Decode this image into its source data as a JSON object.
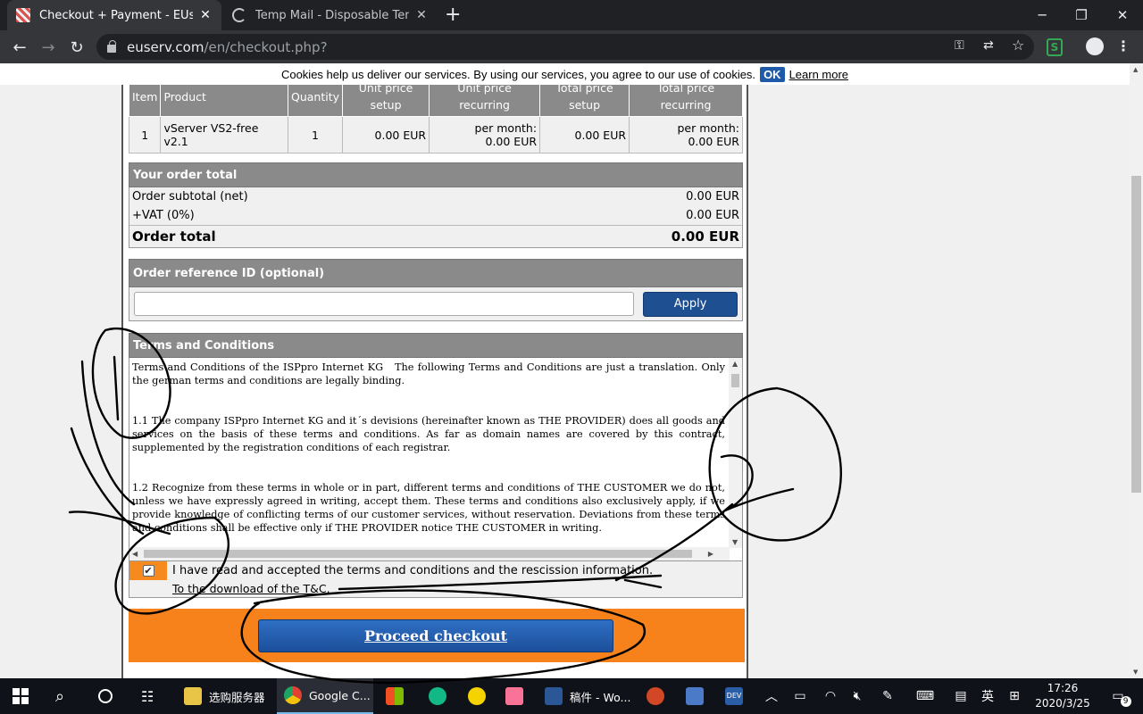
{
  "browser": {
    "tabs": [
      {
        "title": "Checkout + Payment - EUserv",
        "active": true
      },
      {
        "title": "Temp Mail - Disposable Temp",
        "active": false
      }
    ],
    "url_main": "euserv.com",
    "url_path": "/en/checkout.php?"
  },
  "cookie_bar": {
    "text": "Cookies help us deliver our services. By using our services, you agree to our use of cookies.",
    "ok_label": "OK",
    "learn_more": "Learn more"
  },
  "items_table": {
    "headers": [
      "Item",
      "Product",
      "Quantity",
      "Unit price setup",
      "Unit price recurring",
      "Total price setup",
      "Total price recurring"
    ],
    "row": {
      "item": "1",
      "product": "vServer VS2-free v2.1",
      "quantity": "1",
      "unit_setup": "0.00 EUR",
      "unit_recurring_line1": "per month:",
      "unit_recurring_line2": "0.00 EUR",
      "total_setup": "0.00 EUR",
      "total_recurring_line1": "per month:",
      "total_recurring_line2": "0.00 EUR"
    }
  },
  "order_total": {
    "heading": "Your order total",
    "subtotal_label": "Order subtotal (net)",
    "subtotal_value": "0.00 EUR",
    "vat_label": "+VAT (0%)",
    "vat_value": "0.00 EUR",
    "total_label": "Order total",
    "total_value": "0.00 EUR"
  },
  "order_reference": {
    "heading": "Order reference ID (optional)",
    "input_value": "",
    "apply_label": "Apply"
  },
  "terms": {
    "heading": "Terms and Conditions",
    "body": "Terms and Conditions of the ISPpro Internet KG   The following Terms and Conditions are just a translation. Only the german terms and conditions are legally binding.\n\n\n1.1 The company ISPpro Internet KG and it´s devisions (hereinafter known as THE PROVIDER) does all goods and services on the basis of these terms and conditions. As far as domain names are covered by this contract, supplemented by the registration conditions of each registrar.\n\n\n1.2 Recognize from these terms in whole or in part, different terms and conditions of THE CUSTOMER we do not, unless we have expressly agreed in writing, accept them. These terms and conditions also exclusively apply, if we provide knowledge of conflicting terms of our customer services, without reservation. Deviations from these terms and conditions shall be effective only if THE PROVIDER notice THE CUSTOMER in writing.",
    "accept_label": "I have read and accepted the terms and conditions and the rescission information.",
    "accept_checked": true,
    "download_label": "To the download of the T&C."
  },
  "proceed": {
    "label": "Proceed checkout"
  },
  "taskbar": {
    "items": [
      {
        "label": "选购服务器",
        "color": "#e8c547"
      },
      {
        "label": "Google C...",
        "color": "#e34133"
      },
      {
        "label": "稿件 - Wo...",
        "color": "#2b5797"
      }
    ],
    "ime": "英",
    "time": "17:26",
    "date": "2020/3/25",
    "notifications": "9"
  },
  "colors": {
    "section_header": "#8a8a8a",
    "accent_orange": "#f7821b",
    "button_blue": "#1e4f91"
  }
}
